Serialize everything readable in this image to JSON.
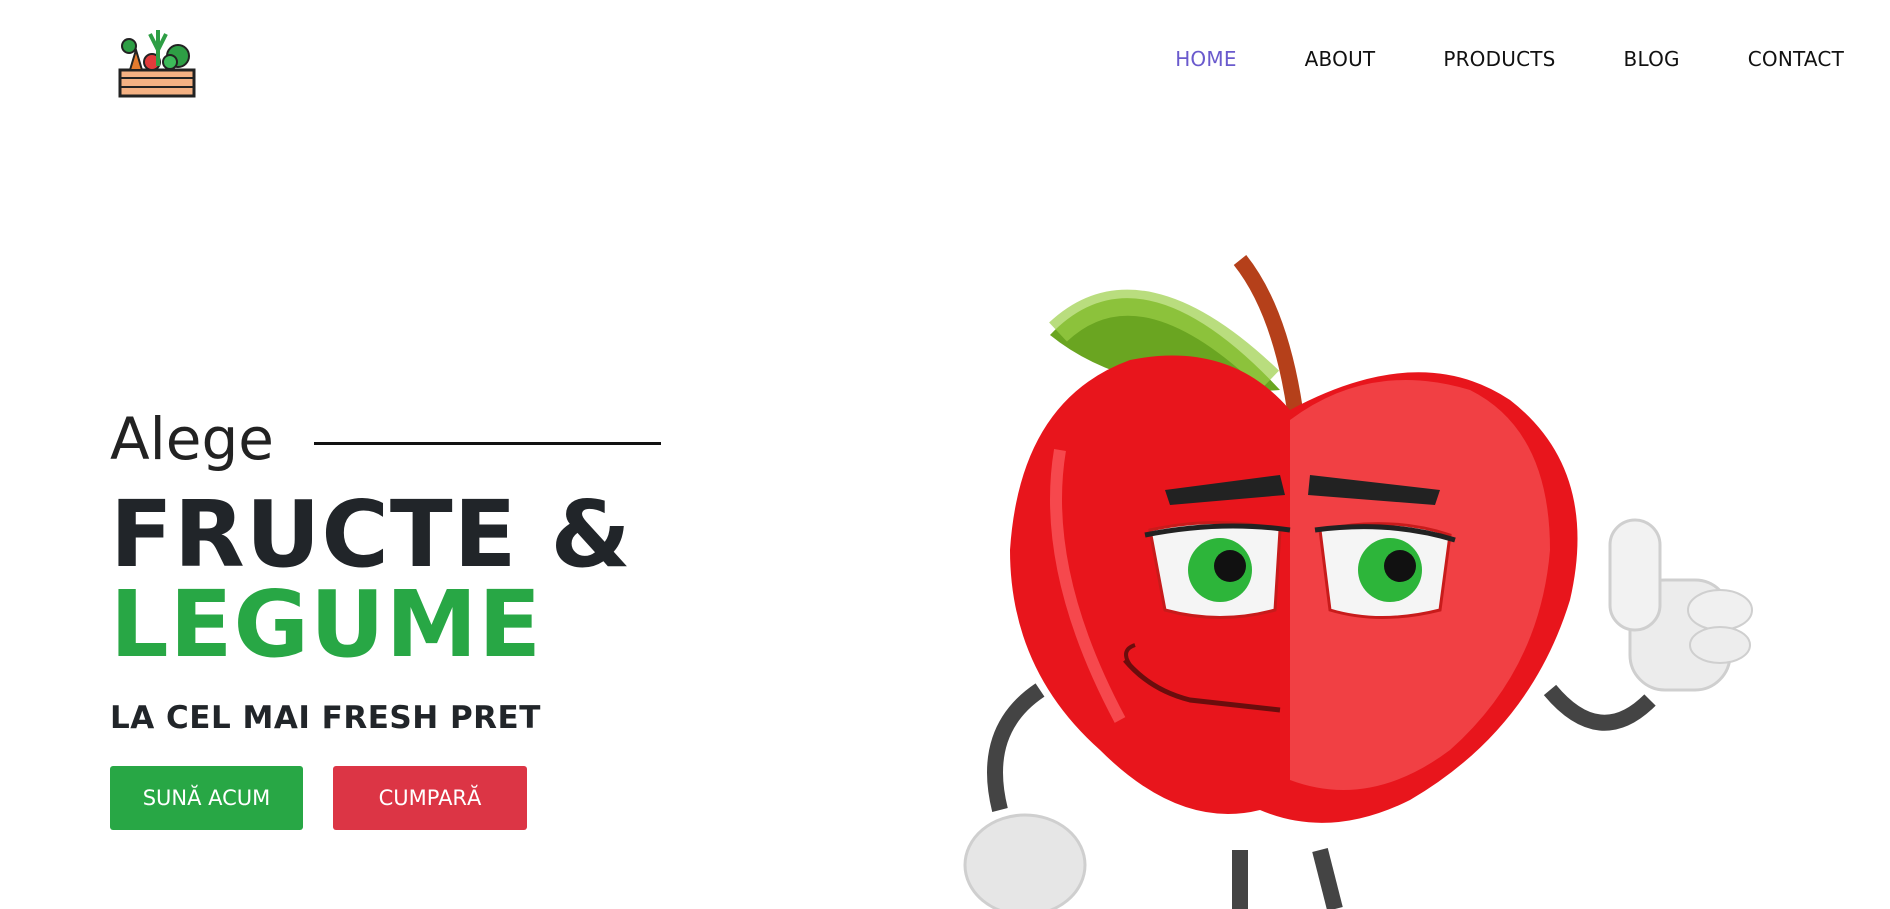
{
  "header": {
    "logo_icon": "vegetable-crate-icon",
    "nav": [
      {
        "label": "HOME",
        "active": true
      },
      {
        "label": "ABOUT",
        "active": false
      },
      {
        "label": "PRODUCTS",
        "active": false
      },
      {
        "label": "BLOG",
        "active": false
      },
      {
        "label": "CONTACT",
        "active": false
      }
    ]
  },
  "hero": {
    "kicker": "Alege",
    "title_line1": "FRUCTE &",
    "title_line2": "LEGUME",
    "subtitle": "LA CEL MAI FRESH PRET",
    "call_button": "SUNĂ ACUM",
    "buy_button": "CUMPARĂ",
    "illustration": "apple-mascot-thumbs-up-illustration"
  },
  "colors": {
    "accent_green": "#28a745",
    "accent_red": "#dc3545",
    "nav_active": "#6a5acd"
  }
}
